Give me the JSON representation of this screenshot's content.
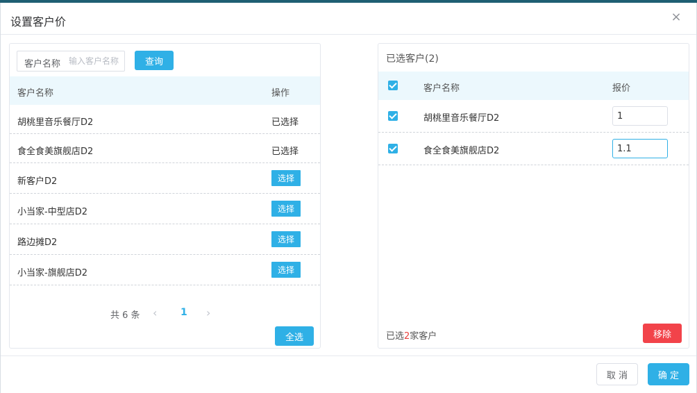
{
  "dialog": {
    "title": "设置客户价",
    "close_icon": "×"
  },
  "left": {
    "search_label": "客户名称",
    "search_placeholder": "输入客户名称",
    "search_value": "",
    "query_label": "查询",
    "columns": [
      "客户名称",
      "操作"
    ],
    "rows": [
      {
        "name": "胡桃里音乐餐厅D2",
        "action": "已选择",
        "selected": true
      },
      {
        "name": "食全食美旗舰店D2",
        "action": "已选择",
        "selected": true
      },
      {
        "name": "新客户D2",
        "action": "选择",
        "selected": false
      },
      {
        "name": "小当家-中型店D2",
        "action": "选择",
        "selected": false
      },
      {
        "name": "路边摊D2",
        "action": "选择",
        "selected": false
      },
      {
        "name": "小当家-旗舰店D2",
        "action": "选择",
        "selected": false
      }
    ],
    "pager": {
      "total": "共 6 条",
      "prev": "‹",
      "page": "1",
      "next": "›"
    },
    "select_all_label": "全选"
  },
  "right": {
    "title": "已选客户(2)",
    "columns": [
      "客户名称",
      "报价"
    ],
    "rows": [
      {
        "name": "胡桃里音乐餐厅D2",
        "price": "1"
      },
      {
        "name": "食全食美旗舰店D2",
        "price": "1.1"
      }
    ],
    "footer_prefix": "已选",
    "footer_count": "2",
    "footer_suffix": "家客户",
    "remove_label": "移除"
  },
  "footer": {
    "cancel_label": "取 消",
    "ok_label": "确 定"
  },
  "colors": {
    "accent": "#2fb0e6",
    "danger": "#f2434a",
    "header_bg": "#ecf8fd"
  }
}
